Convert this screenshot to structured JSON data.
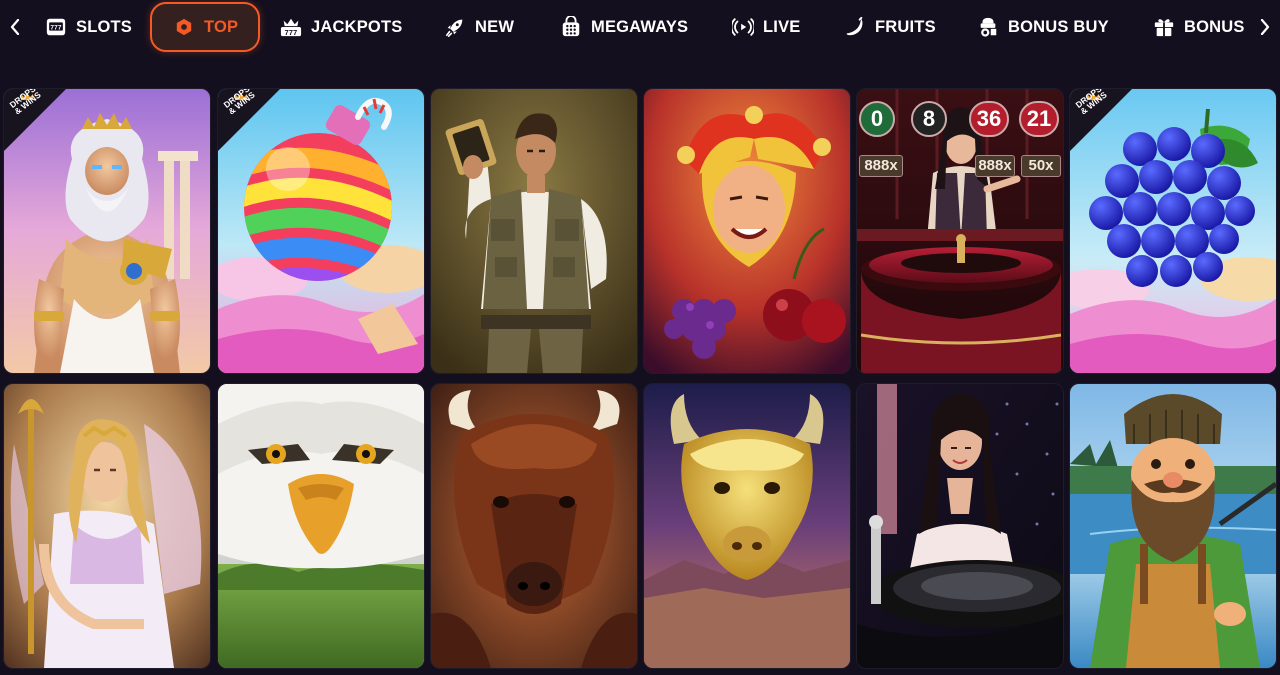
{
  "nav": {
    "tabs": [
      {
        "label": "SLOTS",
        "icon": "slot-machine-icon",
        "active": false
      },
      {
        "label": "TOP",
        "icon": "hexagon-icon",
        "active": true
      },
      {
        "label": "JACKPOTS",
        "icon": "jackpot-777-icon",
        "active": false
      },
      {
        "label": "NEW",
        "icon": "rocket-icon",
        "active": false
      },
      {
        "label": "MEGAWAYS",
        "icon": "megaways-icon",
        "active": false
      },
      {
        "label": "LIVE",
        "icon": "live-broadcast-icon",
        "active": false
      },
      {
        "label": "FRUITS",
        "icon": "banana-icon",
        "active": false
      },
      {
        "label": "BONUS BUY",
        "icon": "bonus-buy-icon",
        "active": false
      },
      {
        "label": "BONUS",
        "icon": "gift-icon",
        "active": false
      }
    ],
    "prev_icon": "chevron-left-icon",
    "next_icon": "chevron-right-icon"
  },
  "badge": {
    "line1": "DROPS",
    "line2": "& WINS"
  },
  "games": [
    {
      "theme": "zeus",
      "badge": true
    },
    {
      "theme": "candy-bomb",
      "badge": true
    },
    {
      "theme": "explorer",
      "badge": false
    },
    {
      "theme": "joker",
      "badge": false
    },
    {
      "theme": "roulette-dealer-wheel",
      "badge": false
    },
    {
      "theme": "grapes",
      "badge": true
    },
    {
      "theme": "goddess",
      "badge": false
    },
    {
      "theme": "eagle",
      "badge": false
    },
    {
      "theme": "buffalo-charge",
      "badge": false
    },
    {
      "theme": "golden-buffalo",
      "badge": false
    },
    {
      "theme": "roulette-dealer",
      "badge": false
    },
    {
      "theme": "lumberjack",
      "badge": false
    }
  ],
  "roulette_numbers": [
    "0",
    "8",
    "36",
    "21"
  ],
  "multipliers": [
    "888x",
    "888x",
    "50x"
  ],
  "colors": {
    "background": "#130f1e",
    "accent": "#f45a25"
  }
}
